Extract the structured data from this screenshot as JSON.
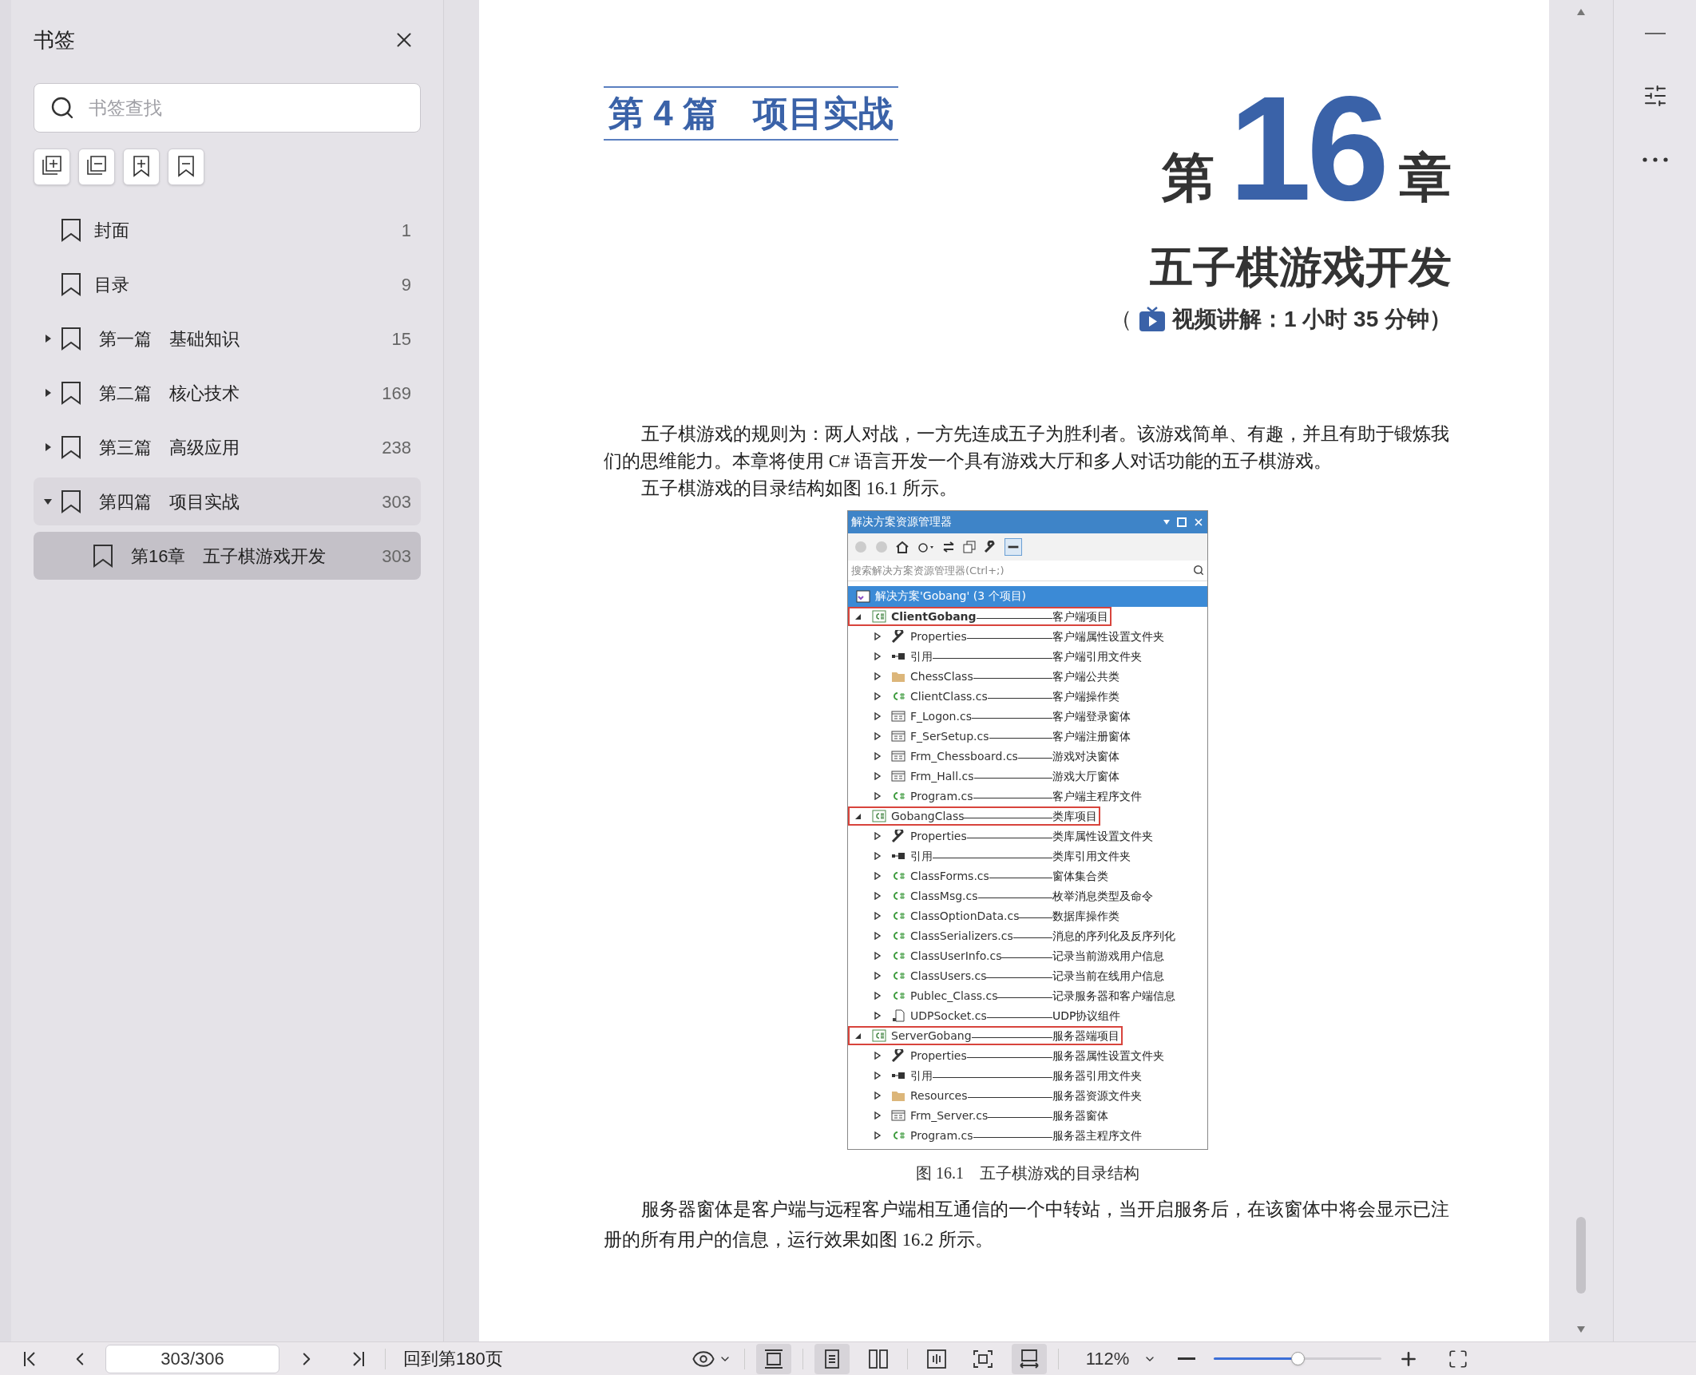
{
  "sidebar": {
    "title": "书签",
    "search": {
      "placeholder": "书签查找"
    },
    "bookmarks": [
      {
        "label": "封面",
        "page": "1",
        "selected": false
      },
      {
        "label": "目录",
        "page": "9",
        "selected": false
      },
      {
        "label": "第一篇　基础知识",
        "page": "15",
        "selected": false,
        "expanded": false
      },
      {
        "label": "第二篇　核心技术",
        "page": "169",
        "selected": false,
        "expanded": false
      },
      {
        "label": "第三篇　高级应用",
        "page": "238",
        "selected": false,
        "expanded": false
      },
      {
        "label": "第四篇　项目实战",
        "page": "303",
        "selected": false,
        "expanded": true,
        "children": [
          {
            "label": "第16章　五子棋游戏开发",
            "page": "303",
            "selected": true
          }
        ]
      }
    ]
  },
  "page": {
    "part_heading": "第 4 篇　项目实战",
    "chapter_prefix": "第",
    "chapter_number": "16",
    "chapter_suffix": "章",
    "chapter_title": "五子棋游戏开发",
    "video_open": "（",
    "video_text": "视频讲解：1 小时 35 分钟）",
    "paragraphs_before": [
      "五子棋游戏的规则为：两人对战，一方先连成五子为胜利者。该游戏简单、有趣，并且有助于锻炼我们的思维能力。本章将使用 C# 语言开发一个具有游戏大厅和多人对话功能的五子棋游戏。",
      "五子棋游戏的目录结构如图 16.1 所示。"
    ],
    "figure": {
      "title": "解决方案资源管理器",
      "search_placeholder": "搜索解决方案资源管理器(Ctrl+;)",
      "solution": {
        "label": "解决方案'Gobang' (3 个项目)",
        "selected": true,
        "children": [
          {
            "name": "ClientGobang",
            "kind": "project",
            "note": "客户端项目",
            "expanded": true,
            "startup": true,
            "marked": true,
            "children": [
              {
                "name": "Properties",
                "kind": "wrench",
                "note": "客户端属性设置文件夹",
                "expanded": false
              },
              {
                "name": "引用",
                "kind": "reference",
                "note": "客户端引用文件夹",
                "expanded": false
              },
              {
                "name": "ChessClass",
                "kind": "folder",
                "note": "客户端公共类",
                "expanded": false
              },
              {
                "name": "ClientClass.cs",
                "kind": "csharp",
                "note": "客户端操作类",
                "expanded": false
              },
              {
                "name": "F_Logon.cs",
                "kind": "form",
                "note": "客户端登录窗体",
                "expanded": false
              },
              {
                "name": "F_SerSetup.cs",
                "kind": "form",
                "note": "客户端注册窗体",
                "expanded": false
              },
              {
                "name": "Frm_Chessboard.cs",
                "kind": "form",
                "note": "游戏对决窗体",
                "expanded": false
              },
              {
                "name": "Frm_Hall.cs",
                "kind": "form",
                "note": "游戏大厅窗体",
                "expanded": false
              },
              {
                "name": "Program.cs",
                "kind": "csharp",
                "note": "客户端主程序文件",
                "expanded": false
              }
            ]
          },
          {
            "name": "GobangClass",
            "kind": "project",
            "note": "类库项目",
            "expanded": true,
            "startup": false,
            "marked": true,
            "children": [
              {
                "name": "Properties",
                "kind": "wrench",
                "note": "类库属性设置文件夹",
                "expanded": false
              },
              {
                "name": "引用",
                "kind": "reference",
                "note": "类库引用文件夹",
                "expanded": false
              },
              {
                "name": "ClassForms.cs",
                "kind": "csharp",
                "note": "窗体集合类",
                "expanded": false
              },
              {
                "name": "ClassMsg.cs",
                "kind": "csharp",
                "note": "枚举消息类型及命令",
                "expanded": false
              },
              {
                "name": "ClassOptionData.cs",
                "kind": "csharp",
                "note": "数据库操作类",
                "expanded": false
              },
              {
                "name": "ClassSerializers.cs",
                "kind": "csharp",
                "note": "消息的序列化及反序列化",
                "expanded": false
              },
              {
                "name": "ClassUserInfo.cs",
                "kind": "csharp",
                "note": "记录当前游戏用户信息",
                "expanded": false
              },
              {
                "name": "ClassUsers.cs",
                "kind": "csharp",
                "note": "记录当前在线用户信息",
                "expanded": false
              },
              {
                "name": "Publec_Class.cs",
                "kind": "csharp",
                "note": "记录服务器和客户端信息",
                "expanded": false
              },
              {
                "name": "UDPSocket.cs",
                "kind": "file",
                "note": "UDP协议组件",
                "expanded": false
              }
            ]
          },
          {
            "name": "ServerGobang",
            "kind": "project",
            "note": "服务器端项目",
            "expanded": true,
            "startup": false,
            "marked": true,
            "children": [
              {
                "name": "Properties",
                "kind": "wrench",
                "note": "服务器属性设置文件夹",
                "expanded": false
              },
              {
                "name": "引用",
                "kind": "reference",
                "note": "服务器引用文件夹",
                "expanded": false
              },
              {
                "name": "Resources",
                "kind": "folder",
                "note": "服务器资源文件夹",
                "expanded": false
              },
              {
                "name": "Frm_Server.cs",
                "kind": "form",
                "note": "服务器窗体",
                "expanded": false
              },
              {
                "name": "Program.cs",
                "kind": "csharp",
                "note": "服务器主程序文件",
                "expanded": false
              }
            ]
          }
        ]
      }
    },
    "caption": "图 16.1　五子棋游戏的目录结构",
    "paragraphs_after": [
      "服务器窗体是客户端与远程客户端相互通信的一个中转站，当开启服务后，在该窗体中将会显示已注册的所有用户的信息，运行效果如图 16.2 所示。"
    ]
  },
  "status_bar": {
    "page_field": "303/306",
    "back_link": "回到第180页",
    "view_buttons": [
      {
        "kind": "continuous",
        "selected": true
      },
      {
        "kind": "single",
        "selected": true
      },
      {
        "kind": "double",
        "selected": false
      },
      {
        "kind": "book",
        "selected": false
      },
      {
        "kind": "fit-page",
        "selected": false
      },
      {
        "kind": "fit-width",
        "selected": true
      }
    ],
    "zoom": "112%",
    "zoom_slider": {
      "level": 0.5
    }
  }
}
